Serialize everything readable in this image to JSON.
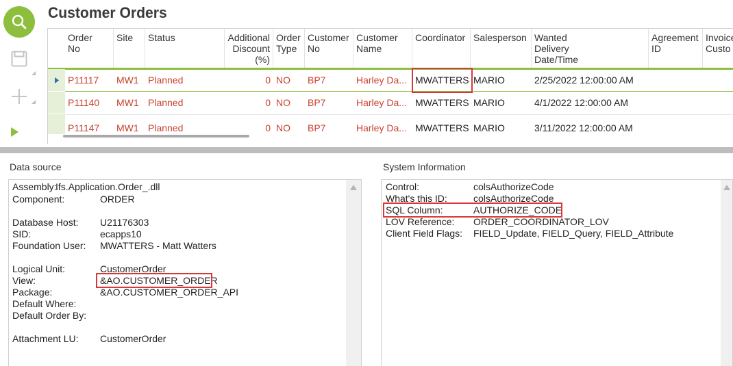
{
  "window": {
    "title": "Customer Orders"
  },
  "toolbar": {
    "search": "search-icon",
    "save": "save-icon",
    "new": "plus-icon",
    "run": "play-icon"
  },
  "grid": {
    "columns": [
      "Order No",
      "Site",
      "Status",
      "Additional Discount (%)",
      "Order Type",
      "Customer No",
      "Customer Name",
      "Coordinator",
      "Salesperson",
      "Wanted Delivery Date/Time",
      "Agreement ID",
      "Invoice Custo"
    ],
    "column_labels": {
      "order_no": [
        "Order",
        "No"
      ],
      "site": "Site",
      "status": "Status",
      "discount": [
        "Additional",
        "Discount",
        "(%)"
      ],
      "order_type": [
        "Order",
        "Type"
      ],
      "customer_no": [
        "Customer",
        "No"
      ],
      "customer_name": [
        "Customer",
        "Name"
      ],
      "coordinator": "Coordinator",
      "salesperson": "Salesperson",
      "wanted_delivery": [
        "Wanted",
        "Delivery",
        "Date/Time"
      ],
      "agreement": [
        "Agreement",
        "ID"
      ],
      "invoice": [
        "Invoice",
        "Custo"
      ]
    },
    "rows": [
      {
        "order_no": "P11117",
        "site": "MW1",
        "status": "Planned",
        "discount": "0",
        "order_type": "NO",
        "customer_no": "BP7",
        "customer_name": "Harley Da...",
        "coordinator": "MWATTERS",
        "salesperson": "MARIO",
        "wanted_delivery": "2/25/2022 12:00:00 AM",
        "selected": true
      },
      {
        "order_no": "P11140",
        "site": "MW1",
        "status": "Planned",
        "discount": "0",
        "order_type": "NO",
        "customer_no": "BP7",
        "customer_name": "Harley Da...",
        "coordinator": "MWATTERS",
        "salesperson": "MARIO",
        "wanted_delivery": "4/1/2022 12:00:00 AM",
        "selected": false
      },
      {
        "order_no": "P11147",
        "site": "MW1",
        "status": "Planned",
        "discount": "0",
        "order_type": "NO",
        "customer_no": "BP7",
        "customer_name": "Harley Da...",
        "coordinator": "MWATTERS",
        "salesperson": "MARIO",
        "wanted_delivery": "3/11/2022 12:00:00 AM",
        "selected": false
      }
    ]
  },
  "data_source": {
    "title": "Data source",
    "assembly_label": "Assembly:",
    "assembly_value": "Ifs.Application.Order_.dll",
    "component_label": "Component:",
    "component_value": "ORDER",
    "db_host_label": "Database Host:",
    "db_host_value": "U21176303",
    "sid_label": "SID:",
    "sid_value": "ecapps10",
    "foundation_user_label": "Foundation User:",
    "foundation_user_value": "MWATTERS - Matt Watters",
    "logical_unit_label": "Logical Unit:",
    "logical_unit_value": "CustomerOrder",
    "view_label": "View:",
    "view_value": "&AO.CUSTOMER_ORDER",
    "package_label": "Package:",
    "package_value": "&AO.CUSTOMER_ORDER_API",
    "default_where_label": "Default Where:",
    "default_order_by_label": "Default Order By:",
    "attachment_lu_label": "Attachment LU:",
    "attachment_lu_value": "CustomerOrder"
  },
  "system_info": {
    "title": "System Information",
    "control_label": "Control:",
    "control_value": "colsAuthorizeCode",
    "whats_id_label": "What's this ID:",
    "whats_id_value": "colsAuthorizeCode",
    "sql_column_label": "SQL Column:",
    "sql_column_value": "AUTHORIZE_CODE",
    "lov_reference_label": "LOV Reference:",
    "lov_reference_value": "ORDER_COORDINATOR_LOV",
    "client_field_flags_label": "Client Field Flags:",
    "client_field_flags_value": "FIELD_Update, FIELD_Query, FIELD_Attribute"
  },
  "colors": {
    "accent": "#8dbe3e",
    "link_red": "#c8412e",
    "highlight_red": "#d9383a"
  }
}
